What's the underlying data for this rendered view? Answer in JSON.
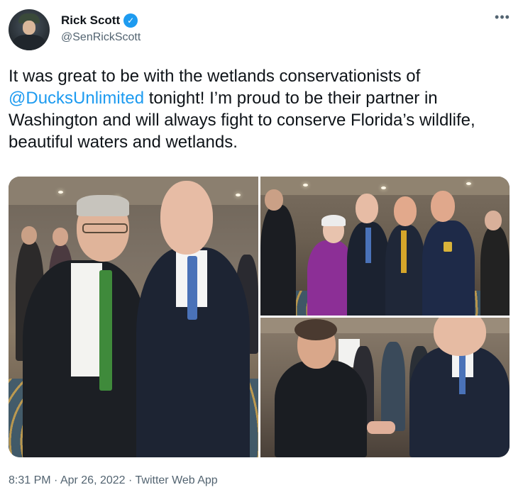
{
  "author": {
    "display_name": "Rick Scott",
    "handle": "@SenRickScott",
    "verified_icon": "verified-badge-icon",
    "verified_glyph": "✓"
  },
  "menu": {
    "more_glyph": "•••"
  },
  "tweet": {
    "text_before": "It was great to be with the wetlands conservationists of ",
    "mention": "@DucksUnlimited",
    "text_after": " tonight! I’m proud to be their partner in Washington and will always fight to conserve Florida’s wildlife, beautiful waters and wetlands."
  },
  "footer": {
    "time": "8:31 PM",
    "separator_1": " · ",
    "date": "Apr 26, 2022",
    "separator_2": " · ",
    "source": "Twitter Web App"
  },
  "colors": {
    "link": "#1d9bf0",
    "text": "#0f1419",
    "secondary": "#536471"
  }
}
